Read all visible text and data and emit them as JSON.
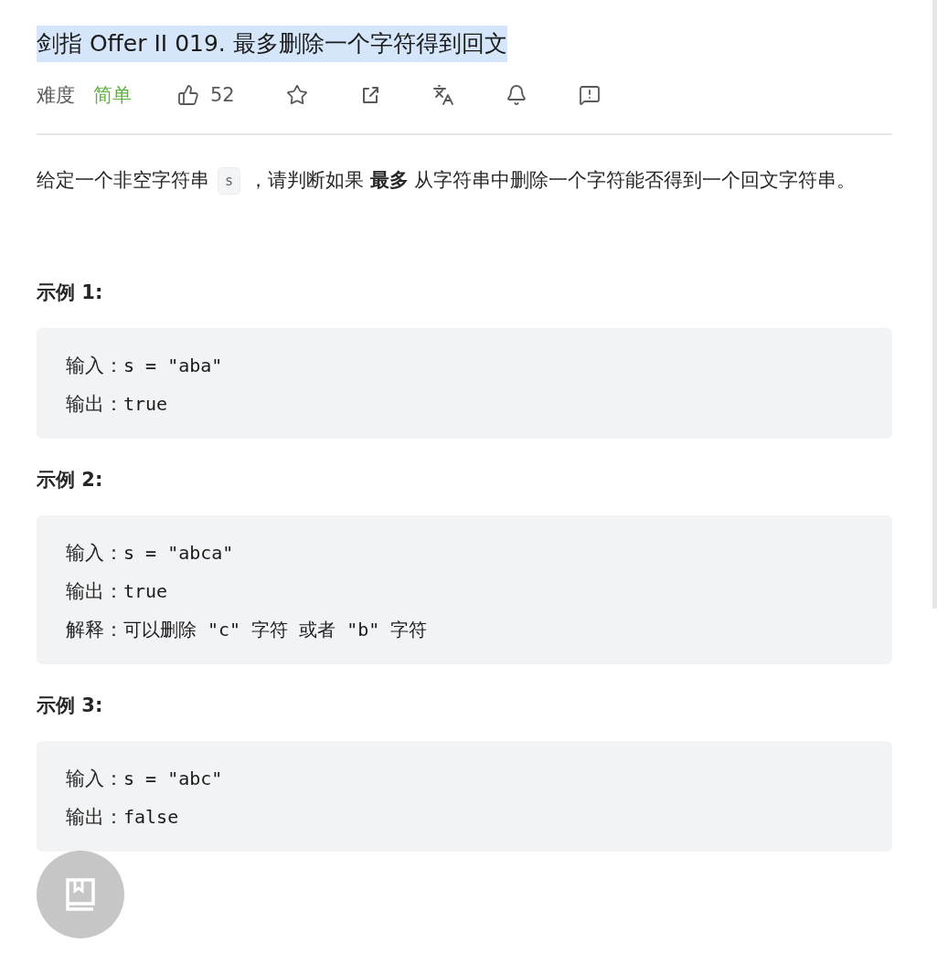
{
  "title": {
    "text": "剑指 Offer II 019. 最多删除一个字符得到回文",
    "selected": true
  },
  "meta": {
    "difficulty_label": "难度",
    "difficulty": "简单",
    "likes": "52"
  },
  "description": {
    "parts": [
      {
        "kind": "text",
        "text": "给定一个非空字符串"
      },
      {
        "kind": "code",
        "text": "s"
      },
      {
        "kind": "text",
        "text": "，请判断如果 **最多** 从字符串中删除一个字符能否得到一个回文字符串。"
      }
    ]
  },
  "examples": [
    {
      "title": "示例 1:",
      "lines": [
        {
          "label": "输入：",
          "value": "s = \"aba\""
        },
        {
          "label": "输出：",
          "value": "true"
        }
      ]
    },
    {
      "title": "示例 2:",
      "lines": [
        {
          "label": "输入：",
          "value": "s = \"abca\""
        },
        {
          "label": "输出：",
          "value": "true"
        },
        {
          "label": "解释：",
          "value": "可以删除 \"c\" 字符 或者 \"b\" 字符"
        }
      ]
    },
    {
      "title": "示例 3:",
      "lines": [
        {
          "label": "输入：",
          "value": "s = \"abc\""
        },
        {
          "label": "输出：",
          "value": "false"
        }
      ]
    }
  ]
}
